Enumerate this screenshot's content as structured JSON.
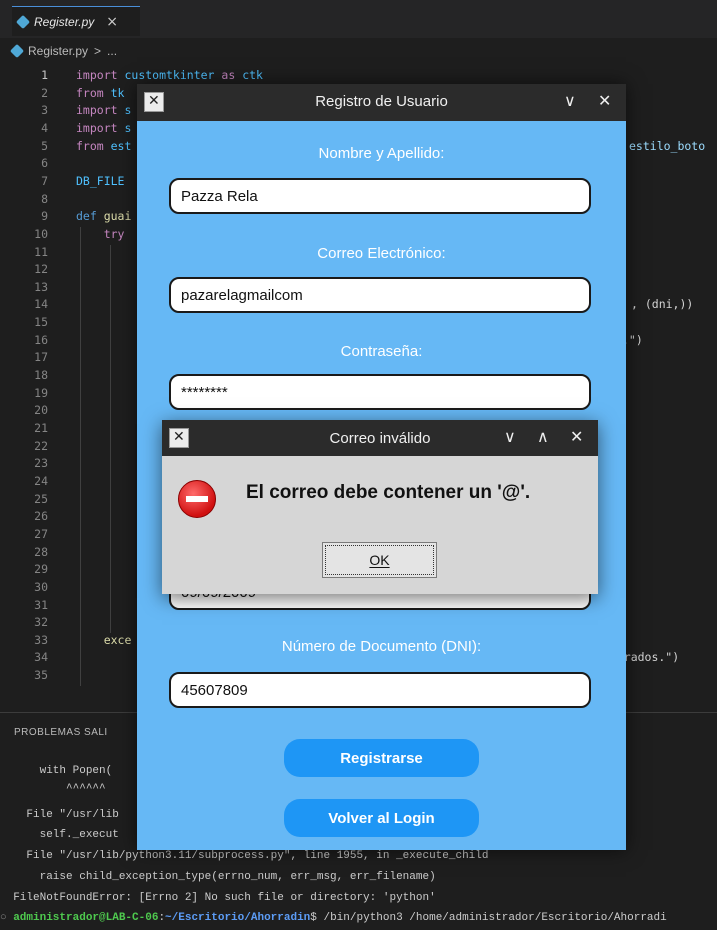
{
  "vscode": {
    "tab_label": "Register.py",
    "tab_close": "×",
    "breadcrumb": [
      "Register.py",
      ">",
      "..."
    ],
    "code_lines": [
      {
        "n": "1",
        "segs": [
          [
            "kw",
            "import "
          ],
          [
            "cst",
            "customtkinter"
          ],
          [
            "kw",
            " as "
          ],
          [
            "cst",
            "ctk"
          ]
        ]
      },
      {
        "n": "2",
        "segs": [
          [
            "kw",
            "from "
          ],
          [
            "cst",
            "tk"
          ]
        ]
      },
      {
        "n": "3",
        "segs": [
          [
            "kw",
            "import "
          ],
          [
            "cst",
            "s"
          ]
        ]
      },
      {
        "n": "4",
        "segs": [
          [
            "kw",
            "import "
          ],
          [
            "cst",
            "s"
          ]
        ]
      },
      {
        "n": "5",
        "segs": [
          [
            "kw",
            "from "
          ],
          [
            "cst",
            "est"
          ]
        ]
      },
      {
        "n": "6",
        "segs": []
      },
      {
        "n": "7",
        "segs": [
          [
            "cst",
            "DB_FILE"
          ]
        ]
      },
      {
        "n": "8",
        "segs": []
      },
      {
        "n": "9",
        "segs": [
          [
            "kb",
            "def "
          ],
          [
            "fn",
            "guai"
          ]
        ]
      },
      {
        "n": "10",
        "segs": [
          [
            "plain",
            "    "
          ],
          [
            "kw",
            "try"
          ]
        ]
      },
      {
        "n": "11",
        "segs": []
      },
      {
        "n": "12",
        "segs": []
      },
      {
        "n": "13",
        "segs": []
      },
      {
        "n": "14",
        "segs": []
      },
      {
        "n": "15",
        "segs": []
      },
      {
        "n": "16",
        "segs": []
      },
      {
        "n": "17",
        "segs": []
      },
      {
        "n": "18",
        "segs": []
      },
      {
        "n": "19",
        "segs": []
      },
      {
        "n": "20",
        "segs": []
      },
      {
        "n": "21",
        "segs": []
      },
      {
        "n": "22",
        "segs": []
      },
      {
        "n": "23",
        "segs": []
      },
      {
        "n": "24",
        "segs": []
      },
      {
        "n": "25",
        "segs": []
      },
      {
        "n": "26",
        "segs": []
      },
      {
        "n": "27",
        "segs": []
      },
      {
        "n": "28",
        "segs": []
      },
      {
        "n": "29",
        "segs": []
      },
      {
        "n": "30",
        "segs": []
      },
      {
        "n": "31",
        "segs": []
      },
      {
        "n": "32",
        "segs": []
      },
      {
        "n": "33",
        "segs": [
          [
            "plain",
            "    "
          ],
          [
            "fn",
            "exce"
          ]
        ]
      },
      {
        "n": "34",
        "segs": []
      },
      {
        "n": "35",
        "segs": []
      }
    ],
    "right_snippets": {
      "l5": "estilo_boto",
      "l14": ", (dni,))",
      "l16": ".\")",
      "l34": "istrados.\")"
    },
    "panel_tabs": "PROBLEMAS    SALI",
    "terminal": [
      "      with Popen(",
      "          ^^^^^^",
      "    File \"/usr/lib",
      "      self._execut",
      "    File \"/usr/lib/python3.11/subprocess.py\", line 1955, in _execute_child",
      "      raise child_exception_type(errno_num, err_msg, err_filename)",
      "  FileNotFoundError: [Errno 2] No such file or directory: 'python'"
    ],
    "prompt": {
      "user": "administrador@LAB-C-06",
      "path": "~/Escritorio/Ahorradin",
      "cmd": "$ /bin/python3 /home/administrador/Escritorio/Ahorradi"
    }
  },
  "register_window": {
    "title": "Registro de Usuario",
    "controls": [
      "∨",
      "✕"
    ],
    "fields": [
      {
        "label": "Nombre y Apellido:",
        "value": "Pazza Rela"
      },
      {
        "label": "Correo Electrónico:",
        "value": "pazarelagmailcom"
      },
      {
        "label": "Contraseña:",
        "value": "********"
      },
      {
        "label": "",
        "value": "09/09/2009"
      },
      {
        "label": "Número de Documento (DNI):",
        "value": "45607809"
      }
    ],
    "register_button": "Registrarse",
    "back_button": "Volver al Login"
  },
  "dialog": {
    "title": "Correo inválido",
    "controls": [
      "∨",
      "∧",
      "✕"
    ],
    "message": "El correo debe contener un '@'.",
    "ok_label": "OK",
    "icon": "error-icon"
  }
}
